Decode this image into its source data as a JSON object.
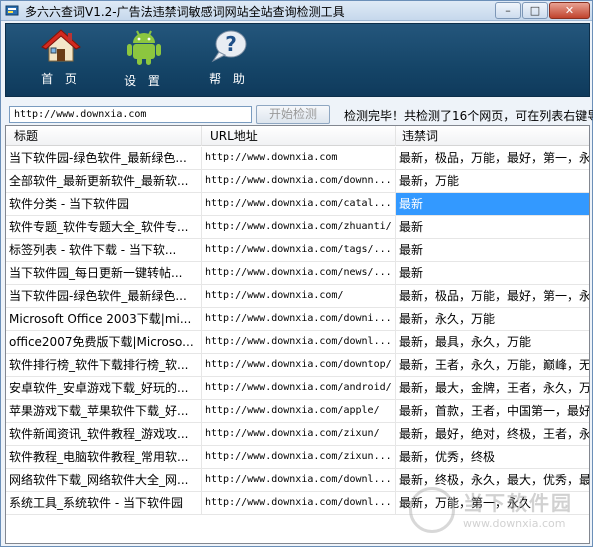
{
  "window": {
    "title": "多六六查词V1.2-广告法违禁词敏感词网站全站查询检测工具",
    "controls": {
      "minimize": "–",
      "maximize": "□",
      "close": "✕"
    }
  },
  "toolbar": {
    "home": {
      "label": "首 页",
      "icon": "house-icon"
    },
    "settings": {
      "label": "设 置",
      "icon": "android-icon"
    },
    "help": {
      "label": "帮 助",
      "icon": "question-bubble-icon"
    }
  },
  "search": {
    "url_value": "http://www.downxia.com",
    "start_button": "开始检测",
    "status": "检测完毕！共检测了16个网页，可在列表右键导"
  },
  "table": {
    "columns": [
      "标题",
      "URL地址",
      "违禁词"
    ],
    "rows": [
      {
        "title": "当下软件园-绿色软件_最新绿色...",
        "url": "http://www.downxia.com",
        "words": "最新，极品，万能，最好，第一，永..."
      },
      {
        "title": "全部软件_最新更新软件_最新软...",
        "url": "http://www.downxia.com/downn...",
        "words": "最新，万能"
      },
      {
        "title": "软件分类 - 当下软件园",
        "url": "http://www.downxia.com/catal...",
        "words": "最新"
      },
      {
        "title": "软件专题_软件专题大全_软件专...",
        "url": "http://www.downxia.com/zhuanti/",
        "words": "最新"
      },
      {
        "title": "标签列表 - 软件下载 - 当下软...",
        "url": "http://www.downxia.com/tags/...",
        "words": "最新"
      },
      {
        "title": "当下软件园_每日更新一键转帖...",
        "url": "http://www.downxia.com/news/...",
        "words": "最新"
      },
      {
        "title": "当下软件园-绿色软件_最新绿色...",
        "url": "http://www.downxia.com/",
        "words": "最新，极品，万能，最好，第一，永..."
      },
      {
        "title": "Microsoft Office 2003下载|mi...",
        "url": "http://www.downxia.com/downi...",
        "words": "最新，永久，万能"
      },
      {
        "title": "office2007免费版下载|Microso...",
        "url": "http://www.downxia.com/downl...",
        "words": "最新，最具，永久，万能"
      },
      {
        "title": "软件排行榜_软件下载排行榜_软...",
        "url": "http://www.downxia.com/downtop/",
        "words": "最新，王者，永久，万能，巅峰，无敌"
      },
      {
        "title": "安卓软件_安卓游戏下载_好玩的...",
        "url": "http://www.downxia.com/android/",
        "words": "最新，最大，金牌，王者，永久，万能"
      },
      {
        "title": "苹果游戏下载_苹果软件下载_好...",
        "url": "http://www.downxia.com/apple/",
        "words": "最新，首款，王者，中国第一，最好..."
      },
      {
        "title": "软件新闻资讯_软件教程_游戏攻...",
        "url": "http://www.downxia.com/zixun/",
        "words": "最新，最好，绝对，终极，王者，永久"
      },
      {
        "title": "软件教程_电脑软件教程_常用软...",
        "url": "http://www.downxia.com/zixun...",
        "words": "最新，优秀，终极"
      },
      {
        "title": "网络软件下载_网络软件大全_网...",
        "url": "http://www.downxia.com/downl...",
        "words": "最新，终极，永久，最大，优秀，最..."
      },
      {
        "title": "系统工具_系统软件 - 当下软件园",
        "url": "http://www.downxia.com/downl...",
        "words": "最新，万能，第一，永久"
      }
    ],
    "selected_row": 2
  },
  "watermark": {
    "cn": "当下软件园",
    "url": "www.downxia.com"
  }
}
